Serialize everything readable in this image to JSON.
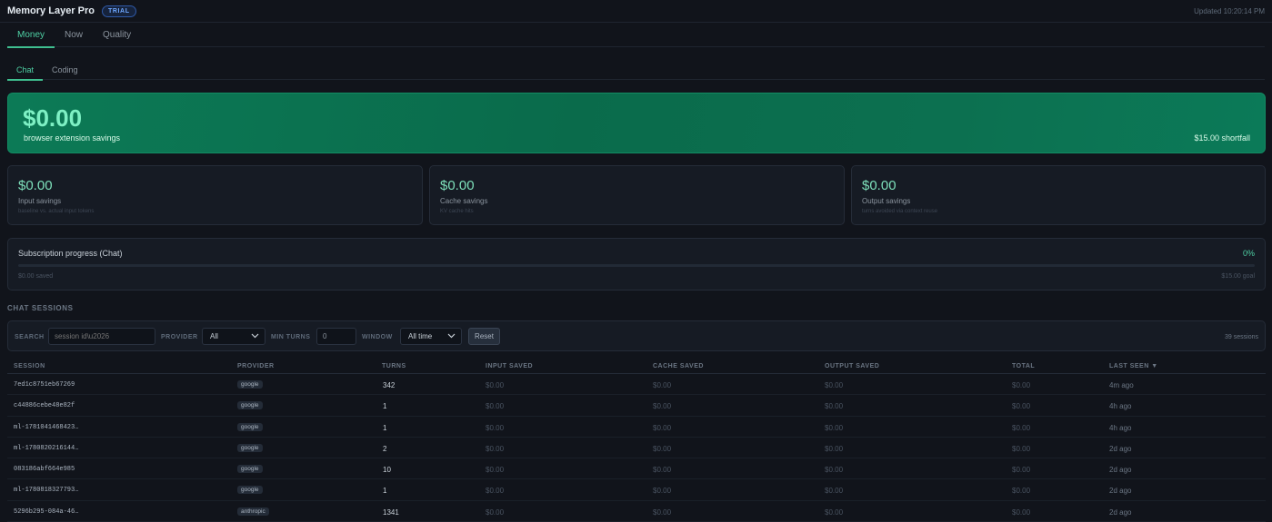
{
  "header": {
    "title": "Memory Layer Pro",
    "badge": "TRIAL",
    "updated": "Updated 10:20:14 PM"
  },
  "main_tabs": [
    {
      "label": "Money",
      "active": true
    },
    {
      "label": "Now"
    },
    {
      "label": "Quality"
    }
  ],
  "sub_tabs": [
    {
      "label": "Chat",
      "active": true
    },
    {
      "label": "Coding"
    }
  ],
  "hero": {
    "amount": "$0.00",
    "label": "browser extension savings",
    "shortfall": "$15.00 shortfall"
  },
  "cards": [
    {
      "value": "$0.00",
      "label": "Input savings",
      "sub": "baseline vs. actual input tokens"
    },
    {
      "value": "$0.00",
      "label": "Cache savings",
      "sub": "KV cache hits"
    },
    {
      "value": "$0.00",
      "label": "Output savings",
      "sub": "turns avoided via context reuse"
    }
  ],
  "progress": {
    "title": "Subscription progress (Chat)",
    "percent_label": "0%",
    "fraction": 0,
    "saved": "$0.00 saved",
    "goal": "$15.00 goal"
  },
  "sessions_section": {
    "title": "CHAT SESSIONS"
  },
  "filters": {
    "search_label": "SEARCH",
    "search_placeholder": "session id\\u2026",
    "provider_label": "PROVIDER",
    "provider_value": "All",
    "min_turns_label": "MIN TURNS",
    "min_turns_value": "0",
    "window_label": "WINDOW",
    "window_value": "All time",
    "reset_label": "Reset",
    "count": "39 sessions"
  },
  "table": {
    "columns": [
      "SESSION",
      "PROVIDER",
      "TURNS",
      "INPUT SAVED",
      "CACHE SAVED",
      "OUTPUT SAVED",
      "TOTAL",
      "LAST SEEN ▼"
    ],
    "rows": [
      {
        "session": "7ed1c8751eb67269",
        "provider": "google",
        "turns": "342",
        "input": "$0.00",
        "cache": "$0.00",
        "output": "$0.00",
        "total": "$0.00",
        "last": "4m ago"
      },
      {
        "session": "c44886cebe48e82f",
        "provider": "google",
        "turns": "1",
        "input": "$0.00",
        "cache": "$0.00",
        "output": "$0.00",
        "total": "$0.00",
        "last": "4h ago"
      },
      {
        "session": "ml-1781041468423…",
        "provider": "google",
        "turns": "1",
        "input": "$0.00",
        "cache": "$0.00",
        "output": "$0.00",
        "total": "$0.00",
        "last": "4h ago"
      },
      {
        "session": "ml-1780820216144…",
        "provider": "google",
        "turns": "2",
        "input": "$0.00",
        "cache": "$0.00",
        "output": "$0.00",
        "total": "$0.00",
        "last": "2d ago"
      },
      {
        "session": "083186abf664e985",
        "provider": "google",
        "turns": "10",
        "input": "$0.00",
        "cache": "$0.00",
        "output": "$0.00",
        "total": "$0.00",
        "last": "2d ago"
      },
      {
        "session": "ml-1780818327793…",
        "provider": "google",
        "turns": "1",
        "input": "$0.00",
        "cache": "$0.00",
        "output": "$0.00",
        "total": "$0.00",
        "last": "2d ago"
      },
      {
        "session": "5296b295-084a-46…",
        "provider": "anthropic",
        "turns": "1341",
        "input": "$0.00",
        "cache": "$0.00",
        "output": "$0.00",
        "total": "$0.00",
        "last": "2d ago"
      }
    ]
  },
  "colors": {
    "accent": "#4fd1a5",
    "hero_bg": "#0a6b4b",
    "panel": "#161b24",
    "page_bg": "#11141b"
  }
}
